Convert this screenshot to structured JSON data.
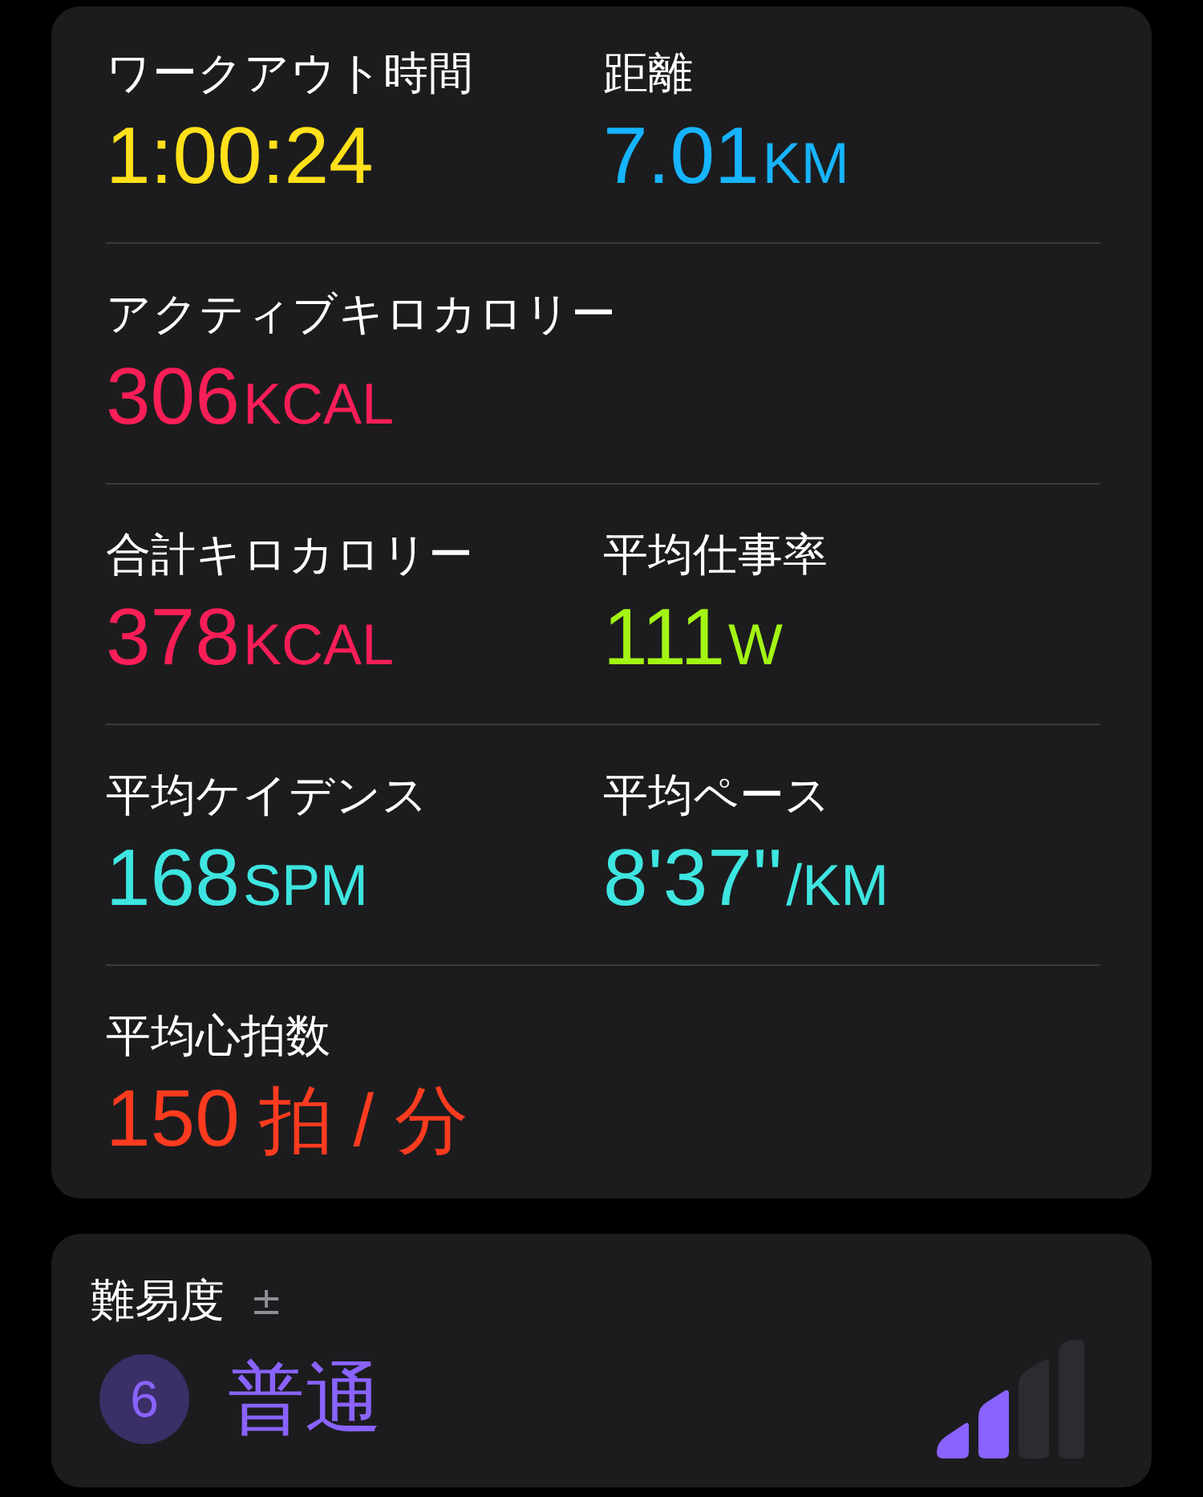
{
  "metrics": [
    [
      {
        "label": "ワークアウト時間",
        "value": "1:00:24",
        "color": "#ffe01a"
      },
      {
        "label": "距離",
        "value": "7.01",
        "unit": "KM",
        "color": "#17b4ff"
      }
    ],
    [
      {
        "label": "アクティブキロカロリー",
        "value": "306",
        "unit": "KCAL",
        "color": "#fa1e57"
      }
    ],
    [
      {
        "label": "合計キロカロリー",
        "value": "378",
        "unit": "KCAL",
        "color": "#fa1e57"
      },
      {
        "label": "平均仕事率",
        "value": "111",
        "unit": "W",
        "color": "#a3f514"
      }
    ],
    [
      {
        "label": "平均ケイデンス",
        "value": "168",
        "unit": "SPM",
        "color": "#3ee5e0"
      },
      {
        "label": "平均ペース",
        "value": "8'37''",
        "unit": "/KM",
        "color": "#3ee5e0"
      }
    ],
    [
      {
        "label": "平均心拍数",
        "value": "150",
        "unit": "拍 / 分",
        "color": "#ff3b1f"
      }
    ]
  ],
  "effort": {
    "label": "難易度",
    "adjust": "±",
    "score": "6",
    "rating": "普通",
    "level": 0.5
  }
}
